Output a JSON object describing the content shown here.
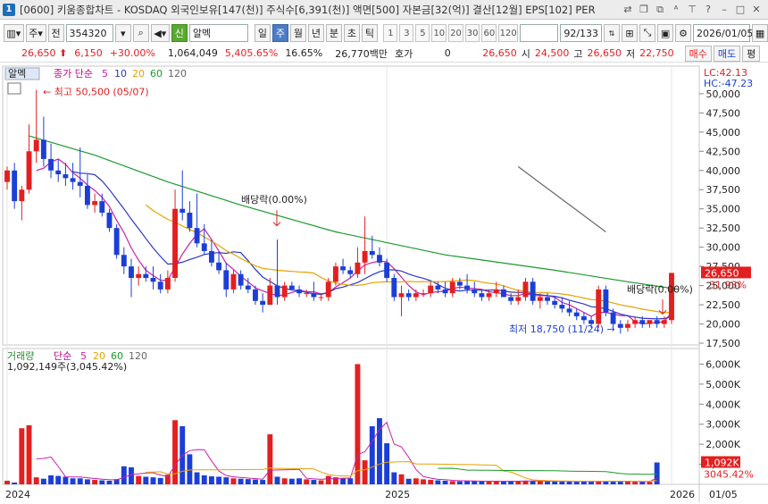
{
  "window": {
    "number": "1",
    "title": "[0600] 키움종합차트 - KOSDAQ 외국인보유[147(천)] 주식수[6,391(천)] 액면[500] 자본금[32(억)] 결산[12월] EPS[102] PER"
  },
  "toolbar": {
    "market_label": "주",
    "prev_label": "전",
    "code": "354320",
    "stock_name": "알멕",
    "periods": [
      "일",
      "주",
      "월",
      "년",
      "분",
      "초",
      "틱"
    ],
    "active_period": "주",
    "numbers": [
      "1",
      "3",
      "5",
      "10",
      "20",
      "30",
      "60",
      "120"
    ],
    "page_counter": "92/133",
    "date": "2026/01/05"
  },
  "info": {
    "price": "26,650",
    "change": "6,150",
    "change_pct": "+30.00%",
    "volume": "1,064,049",
    "volume_ratio": "5,405.65%",
    "turnover": "16.65%",
    "amount": "26,770백만",
    "bid_label": "호가",
    "bid_value": "0",
    "bid_price": "26,650",
    "open_label": "시",
    "open": "24,500",
    "high_label": "고",
    "high": "26,650",
    "low_label": "저",
    "low": "22,750",
    "buy_label": "매수",
    "sell_label": "매도",
    "eval_label": "평"
  },
  "price_panel": {
    "stock_tag": "알멕",
    "ma_title": "종가 단순",
    "ma_periods": [
      "5",
      "10",
      "20",
      "60",
      "120"
    ],
    "ma_colors": [
      "#cc1fa8",
      "#2b37c4",
      "#e8a200",
      "#1a9a2a",
      "#666666"
    ],
    "lc": "LC:42.13",
    "hc": "HC:-47.23",
    "price_ticks": [
      "50,000",
      "47,500",
      "45,000",
      "42,500",
      "40,000",
      "37,500",
      "35,000",
      "32,500",
      "30,000",
      "27,500",
      "25,000",
      "22,500",
      "20,000",
      "17,500"
    ],
    "last_price_tag": "26,650",
    "pct_tag": "31.93%",
    "high_note": "최고 50,500 (05/07)",
    "low_note": "최저 18,750 (11/24)",
    "div_note_1": "배당락(0.00%)",
    "div_note_2": "배당락(0.00%)"
  },
  "volume_panel": {
    "title": "거래량",
    "ma_title": "단순",
    "ma_periods": [
      "5",
      "20",
      "60",
      "120"
    ],
    "ma_colors": [
      "#cc1fa8",
      "#e8a200",
      "#1a9a2a",
      "#666666"
    ],
    "last_volume_text": "1,092,149주(3,045.42%)",
    "volume_ticks": [
      "6,000K",
      "5,000K",
      "4,000K",
      "3,000K",
      "2,000K",
      "1,000K"
    ],
    "last_volume_tag": "1,092K",
    "pct_tag": "3045.42%"
  },
  "x_axis": {
    "labels": [
      "2024",
      "2025",
      "2026"
    ],
    "right_label": "01/05"
  },
  "chart_data": {
    "type": "candlestick",
    "period": "weekly",
    "candles": [
      [
        38500,
        40500,
        37500,
        40000
      ],
      [
        40000,
        41000,
        35000,
        36000
      ],
      [
        36000,
        38000,
        33500,
        37500
      ],
      [
        37500,
        46000,
        37000,
        42500
      ],
      [
        42500,
        50500,
        41000,
        44000
      ],
      [
        44000,
        47000,
        40500,
        41500
      ],
      [
        41500,
        43500,
        39000,
        40000
      ],
      [
        40000,
        41500,
        38500,
        39500
      ],
      [
        39500,
        41000,
        38000,
        39000
      ],
      [
        39000,
        41000,
        37500,
        38500
      ],
      [
        38500,
        43000,
        36500,
        38000
      ],
      [
        38000,
        39500,
        35000,
        35500
      ],
      [
        35500,
        37000,
        34500,
        36000
      ],
      [
        36000,
        37000,
        34000,
        34500
      ],
      [
        34500,
        35000,
        32000,
        32500
      ],
      [
        32500,
        33000,
        28500,
        29000
      ],
      [
        29000,
        30000,
        26500,
        27500
      ],
      [
        27500,
        28500,
        23500,
        26000
      ],
      [
        26000,
        27500,
        25000,
        26500
      ],
      [
        26500,
        27500,
        25500,
        26000
      ],
      [
        26000,
        27500,
        24500,
        25500
      ],
      [
        25500,
        26500,
        24000,
        24500
      ],
      [
        24500,
        27000,
        24000,
        26000
      ],
      [
        26000,
        37500,
        25500,
        35000
      ],
      [
        35000,
        40000,
        33500,
        34500
      ],
      [
        34500,
        36000,
        32000,
        32500
      ],
      [
        32500,
        37000,
        30000,
        30500
      ],
      [
        30500,
        33000,
        29000,
        29500
      ],
      [
        29500,
        31000,
        27500,
        28000
      ],
      [
        28000,
        29500,
        26500,
        27000
      ],
      [
        27000,
        28000,
        23500,
        24500
      ],
      [
        24500,
        27000,
        24000,
        26500
      ],
      [
        26500,
        27000,
        24500,
        25000
      ],
      [
        25000,
        26000,
        24000,
        24500
      ],
      [
        24500,
        25000,
        22500,
        23000
      ],
      [
        23000,
        24000,
        21500,
        22500
      ],
      [
        22500,
        26000,
        22500,
        25000
      ],
      [
        25000,
        31000,
        22500,
        23500
      ],
      [
        23500,
        25500,
        23000,
        25000
      ],
      [
        25000,
        25500,
        24500,
        24500
      ],
      [
        24500,
        25000,
        23500,
        24000
      ],
      [
        24000,
        24500,
        23500,
        24000
      ],
      [
        24000,
        25500,
        23000,
        23500
      ],
      [
        23500,
        24000,
        23000,
        23500
      ],
      [
        23500,
        26000,
        23000,
        25500
      ],
      [
        25500,
        28000,
        25000,
        27500
      ],
      [
        27500,
        28500,
        26500,
        27000
      ],
      [
        27000,
        27500,
        26000,
        26500
      ],
      [
        26500,
        30000,
        26000,
        28000
      ],
      [
        28000,
        34000,
        26500,
        29500
      ],
      [
        29500,
        31500,
        28500,
        29000
      ],
      [
        29000,
        30000,
        27500,
        28000
      ],
      [
        28000,
        28500,
        25500,
        26000
      ],
      [
        26000,
        26500,
        23000,
        23500
      ],
      [
        23500,
        25000,
        21000,
        24000
      ],
      [
        24000,
        24500,
        23000,
        23500
      ],
      [
        23500,
        24500,
        23000,
        24000
      ],
      [
        24000,
        24500,
        23500,
        24000
      ],
      [
        24000,
        25500,
        23500,
        25000
      ],
      [
        25000,
        25500,
        24000,
        24500
      ],
      [
        24500,
        25500,
        23500,
        24000
      ],
      [
        24000,
        26000,
        23500,
        25500
      ],
      [
        25500,
        26000,
        24500,
        25000
      ],
      [
        25000,
        26500,
        24000,
        24500
      ],
      [
        24500,
        25500,
        23500,
        24000
      ],
      [
        24000,
        24500,
        23000,
        23500
      ],
      [
        23500,
        24500,
        23000,
        24000
      ],
      [
        24000,
        25500,
        23500,
        24500
      ],
      [
        24500,
        25000,
        23500,
        23500
      ],
      [
        23500,
        24000,
        22500,
        23000
      ],
      [
        23000,
        24500,
        22500,
        23500
      ],
      [
        23500,
        26000,
        23000,
        25500
      ],
      [
        25500,
        26000,
        22500,
        23000
      ],
      [
        23000,
        24000,
        22000,
        23500
      ],
      [
        23500,
        24000,
        22500,
        23000
      ],
      [
        23000,
        23500,
        22000,
        22500
      ],
      [
        22500,
        23500,
        21500,
        22000
      ],
      [
        22000,
        23000,
        21000,
        21500
      ],
      [
        21500,
        22000,
        20500,
        21000
      ],
      [
        21000,
        21500,
        20000,
        20500
      ],
      [
        20500,
        21000,
        19500,
        20000
      ],
      [
        20000,
        25000,
        19500,
        24500
      ],
      [
        24500,
        25000,
        21000,
        21500
      ],
      [
        21500,
        22000,
        19500,
        20000
      ],
      [
        20000,
        20500,
        18750,
        19500
      ],
      [
        19500,
        20500,
        19000,
        20000
      ],
      [
        20000,
        21000,
        19500,
        20500
      ],
      [
        20500,
        21000,
        19500,
        20000
      ],
      [
        20000,
        20500,
        19500,
        20500
      ],
      [
        20500,
        21000,
        19500,
        20000
      ],
      [
        20000,
        21000,
        19500,
        20500
      ],
      [
        20500,
        26650,
        20000,
        26650
      ]
    ],
    "volumes_k": [
      180,
      90,
      2800,
      2950,
      350,
      280,
      450,
      420,
      380,
      300,
      300,
      250,
      220,
      200,
      180,
      260,
      900,
      850,
      420,
      380,
      350,
      320,
      480,
      3200,
      2900,
      1500,
      600,
      450,
      400,
      380,
      350,
      300,
      280,
      260,
      240,
      220,
      2500,
      380,
      300,
      280,
      300,
      250,
      220,
      200,
      420,
      350,
      320,
      300,
      6000,
      1200,
      2900,
      3300,
      2050,
      600,
      500,
      280,
      300,
      250,
      220,
      200,
      180,
      160,
      150,
      170,
      160,
      150,
      140,
      160,
      150,
      170,
      160,
      180,
      160,
      150,
      140,
      160,
      150,
      140,
      130,
      150,
      140,
      180,
      160,
      140,
      150,
      140,
      130,
      140,
      120,
      1092
    ],
    "x_labels": [
      "2024",
      "2025",
      "2026"
    ],
    "ylim": [
      17500,
      51500
    ]
  }
}
